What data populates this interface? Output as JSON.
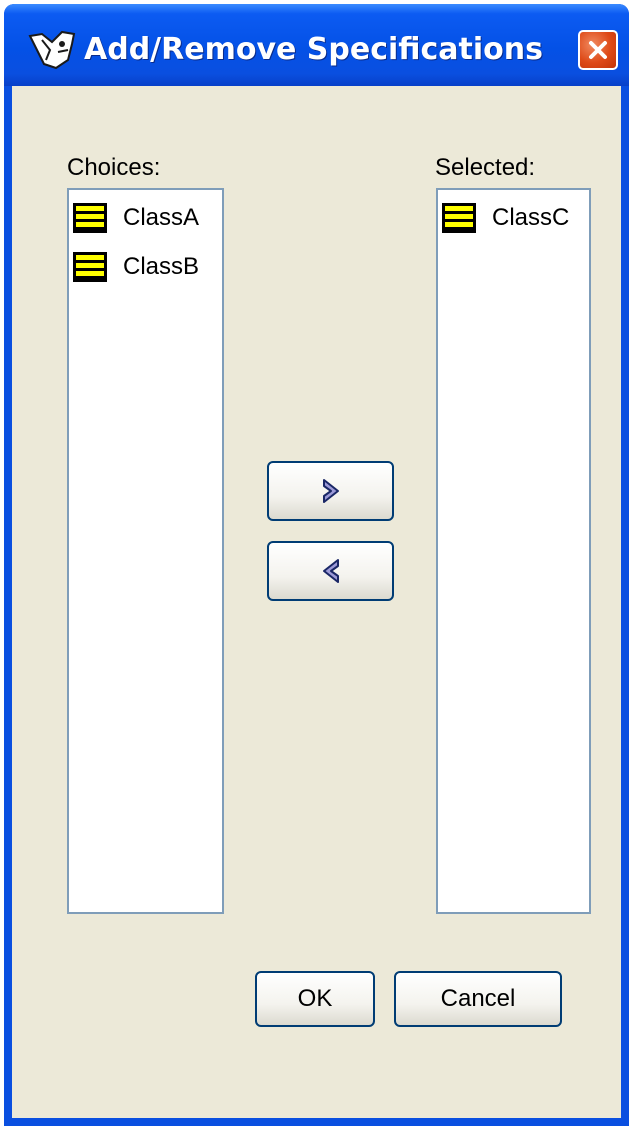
{
  "window": {
    "title": "Add/Remove Specifications",
    "title_icon": "app-logo-icon",
    "close_icon": "close-icon",
    "title_bar_color": "#0a4fe0",
    "close_color": "#de4a18",
    "body_color": "#ece9d8"
  },
  "choices": {
    "label": "Choices:",
    "items": [
      {
        "label": "ClassA",
        "icon": "class-icon"
      },
      {
        "label": "ClassB",
        "icon": "class-icon"
      }
    ]
  },
  "selected": {
    "label": "Selected:",
    "items": [
      {
        "label": "ClassC",
        "icon": "class-icon"
      }
    ]
  },
  "transfer": {
    "add_icon": "chevron-right-icon",
    "remove_icon": "chevron-left-icon"
  },
  "footer": {
    "ok_label": "OK",
    "cancel_label": "Cancel"
  }
}
